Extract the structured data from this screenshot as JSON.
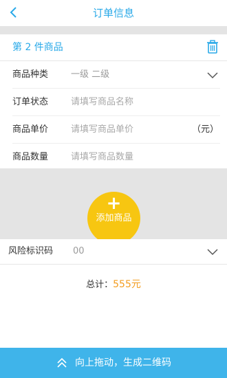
{
  "header": {
    "title": "订单信息"
  },
  "product_card": {
    "title": "第 2 件商品",
    "rows": [
      {
        "label": "商品种类",
        "value": "一级 二级"
      },
      {
        "label": "订单状态",
        "placeholder": "请填写商品名称"
      },
      {
        "label": "商品单价",
        "placeholder": "请填写商品单价",
        "unit": "（元）"
      },
      {
        "label": "商品数量",
        "placeholder": "请填写商品数量"
      }
    ]
  },
  "add_button": {
    "symbol": "+",
    "label": "添加商品"
  },
  "risk": {
    "label": "风险标识码",
    "value": "00"
  },
  "total": {
    "label": "总计：",
    "amount": "555元"
  },
  "bottom_bar": {
    "label": "向上拖动，生成二维码"
  },
  "colors": {
    "accent_blue": "#29a9e8",
    "button_yellow": "#f7c611",
    "amount_orange": "#f39c1e",
    "bottom_bar": "#3fb4ea"
  },
  "icons": {
    "back": "chevron-left-icon",
    "delete": "trash-icon",
    "dropdown": "chevron-down-icon",
    "bottom": "double-chevron-up-icon"
  }
}
